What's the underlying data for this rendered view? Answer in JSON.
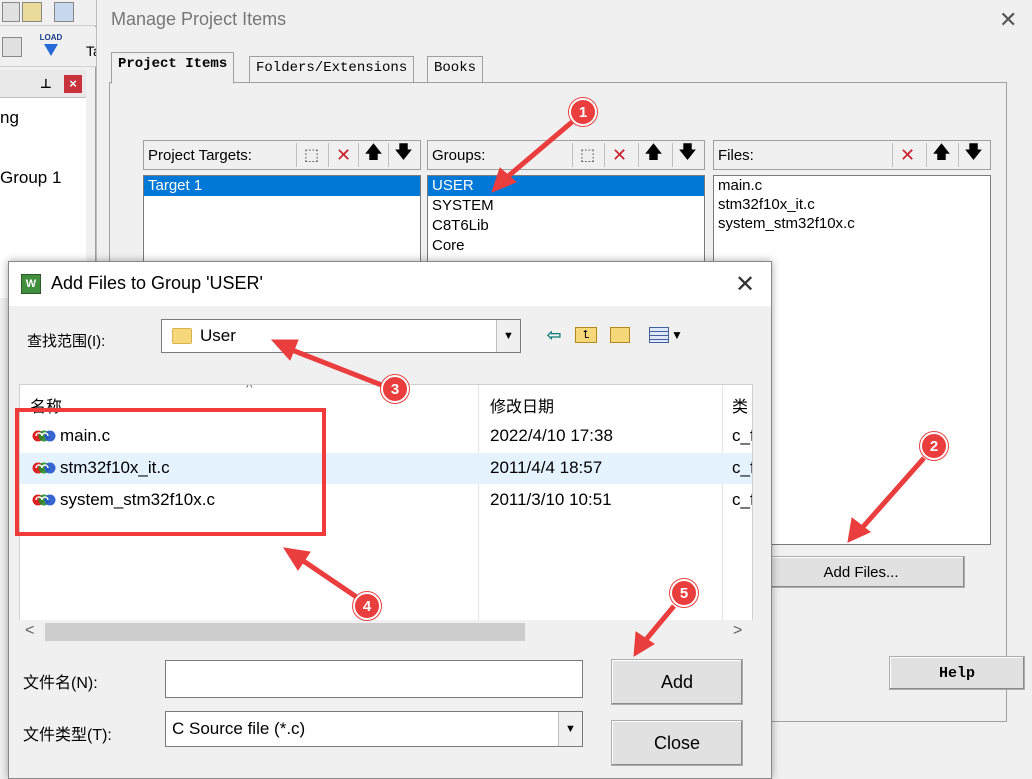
{
  "ide": {
    "tree_item_1": "ng",
    "tree_item_2": "Group 1",
    "toolbar_partial": "Ta",
    "load_label": "LOAD"
  },
  "manage_dialog": {
    "title": "Manage Project Items",
    "close": "✕",
    "tabs": [
      "Project Items",
      "Folders/Extensions",
      "Books"
    ],
    "targets": {
      "label": "Project Targets:",
      "items": [
        "Target 1"
      ],
      "selected": 0
    },
    "groups": {
      "label": "Groups:",
      "items": [
        "USER",
        "SYSTEM",
        "C8T6Lib",
        "Core"
      ],
      "selected": 0
    },
    "files": {
      "label": "Files:",
      "items": [
        "main.c",
        "stm32f10x_it.c",
        "system_stm32f10x.c"
      ]
    },
    "add_files_button": "Add Files...",
    "help_button": "Help"
  },
  "add_files_dialog": {
    "title": "Add Files to Group 'USER'",
    "close": "✕",
    "look_in_label": "查找范围(I):",
    "look_in_value": "User",
    "columns": {
      "name": "名称",
      "date": "修改日期",
      "type": "类"
    },
    "files": [
      {
        "name": "main.c",
        "date": "2022/4/10 17:38",
        "type": "c_f"
      },
      {
        "name": "stm32f10x_it.c",
        "date": "2011/4/4 18:57",
        "type": "c_f"
      },
      {
        "name": "system_stm32f10x.c",
        "date": "2011/3/10 10:51",
        "type": "c_f"
      }
    ],
    "filename_label": "文件名(N):",
    "filename_value": "",
    "filetype_label": "文件类型(T):",
    "filetype_value": "C Source file (*.c)",
    "add_button": "Add",
    "close_button": "Close"
  },
  "annotations": {
    "markers": [
      "1",
      "2",
      "3",
      "4",
      "5"
    ],
    "color": "#ea3d3d"
  }
}
